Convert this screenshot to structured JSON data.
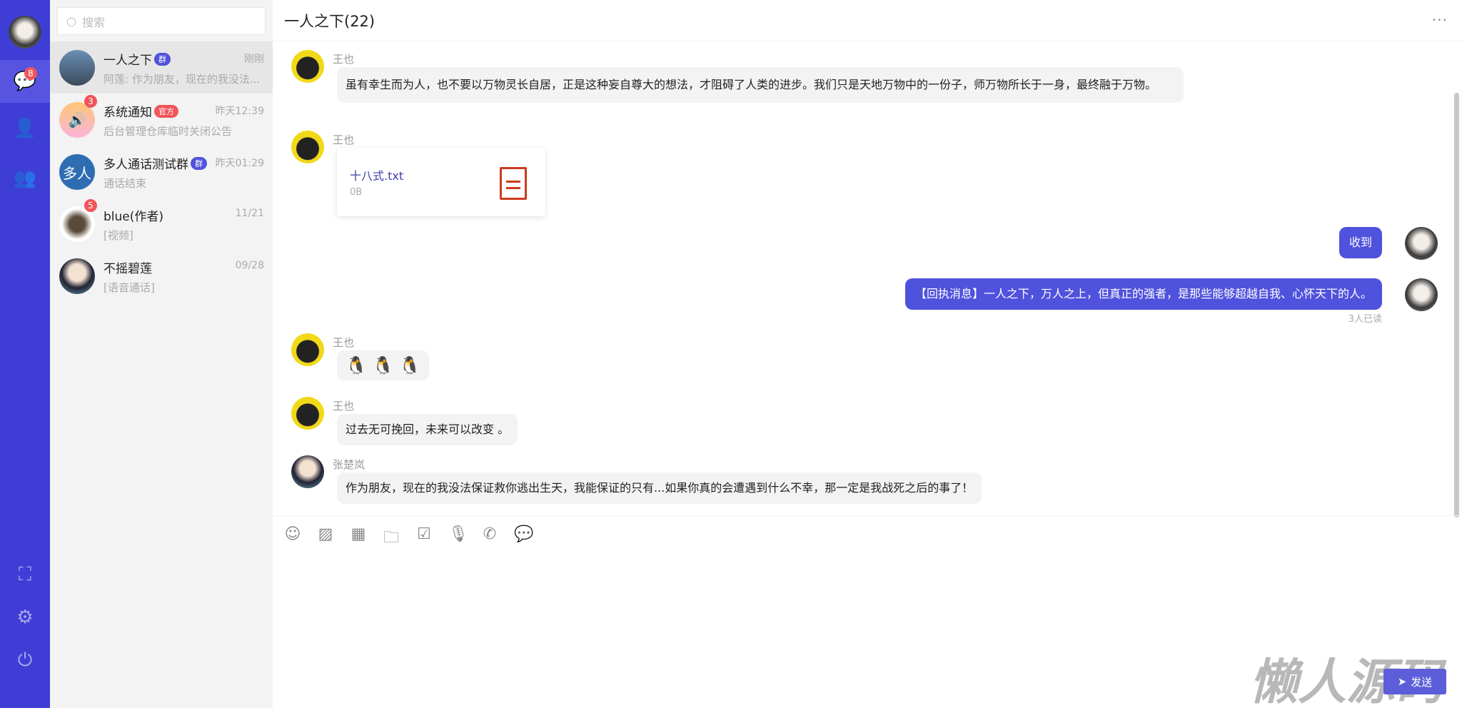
{
  "nav": {
    "chat_badge": "8",
    "icons": [
      "chat-icon",
      "contacts-icon",
      "group-icon",
      "fullscreen-icon",
      "settings-icon",
      "power-icon"
    ]
  },
  "search": {
    "placeholder": "搜索"
  },
  "conversations": [
    {
      "name": "一人之下",
      "tag": "群",
      "tag_color": "#4f52dc",
      "time": "刚刚",
      "preview": "阿莲: 作为朋友，现在的我没法...",
      "badge": ""
    },
    {
      "name": "系统通知",
      "tag": "官方",
      "tag_color": "#f0555a",
      "time": "昨天12:39",
      "preview": "后台管理仓库临时关闭公告",
      "badge": "3"
    },
    {
      "name": "多人通话测试群",
      "tag": "群",
      "tag_color": "#4f52dc",
      "time": "昨天01:29",
      "preview": "通话结束",
      "badge": "",
      "avatar_text": "多人"
    },
    {
      "name": "blue(作者)",
      "tag": "",
      "time": "11/21",
      "preview": "[视频]",
      "badge": "5"
    },
    {
      "name": "不摇碧莲",
      "tag": "",
      "time": "09/28",
      "preview": "[语音通话]",
      "badge": ""
    }
  ],
  "chat": {
    "title": "一人之下(22)",
    "more": "···"
  },
  "messages": [
    {
      "sender": "王也",
      "text": "虽有幸生而为人，也不要以万物灵长自居，正是这种妄自尊大的想法，才阻碍了人类的进步。我们只是天地万物中的一份子，师万物所长于一身，最终融于万物。"
    },
    {
      "sender": "王也",
      "file_name": "十八式.txt",
      "file_size": "0B"
    },
    {
      "self": true,
      "text": "收到"
    },
    {
      "self": true,
      "text": "【回执消息】一人之下，万人之上，但真正的强者，是那些能够超越自我、心怀天下的人。",
      "read": "3人已读"
    },
    {
      "sender": "王也",
      "emoji": "🐧 🐧 🐧"
    },
    {
      "sender": "王也",
      "text": "过去无可挽回，未来可以改变 。"
    },
    {
      "sender": "张楚岚",
      "text": "作为朋友，现在的我没法保证救你逃出生天，我能保证的只有...如果你真的会遭遇到什么不幸，那一定是我战死之后的事了！"
    }
  ],
  "toolbar": [
    "emoji-icon",
    "image-icon",
    "table-icon",
    "folder-icon",
    "check-icon",
    "mic-icon",
    "phone-icon",
    "comment-icon"
  ],
  "send": {
    "label": "发送"
  },
  "watermark": "懒人源码",
  "colors": {
    "nav": "#3e3dd6",
    "accent": "#4f52dc",
    "badge": "#f0555a"
  }
}
